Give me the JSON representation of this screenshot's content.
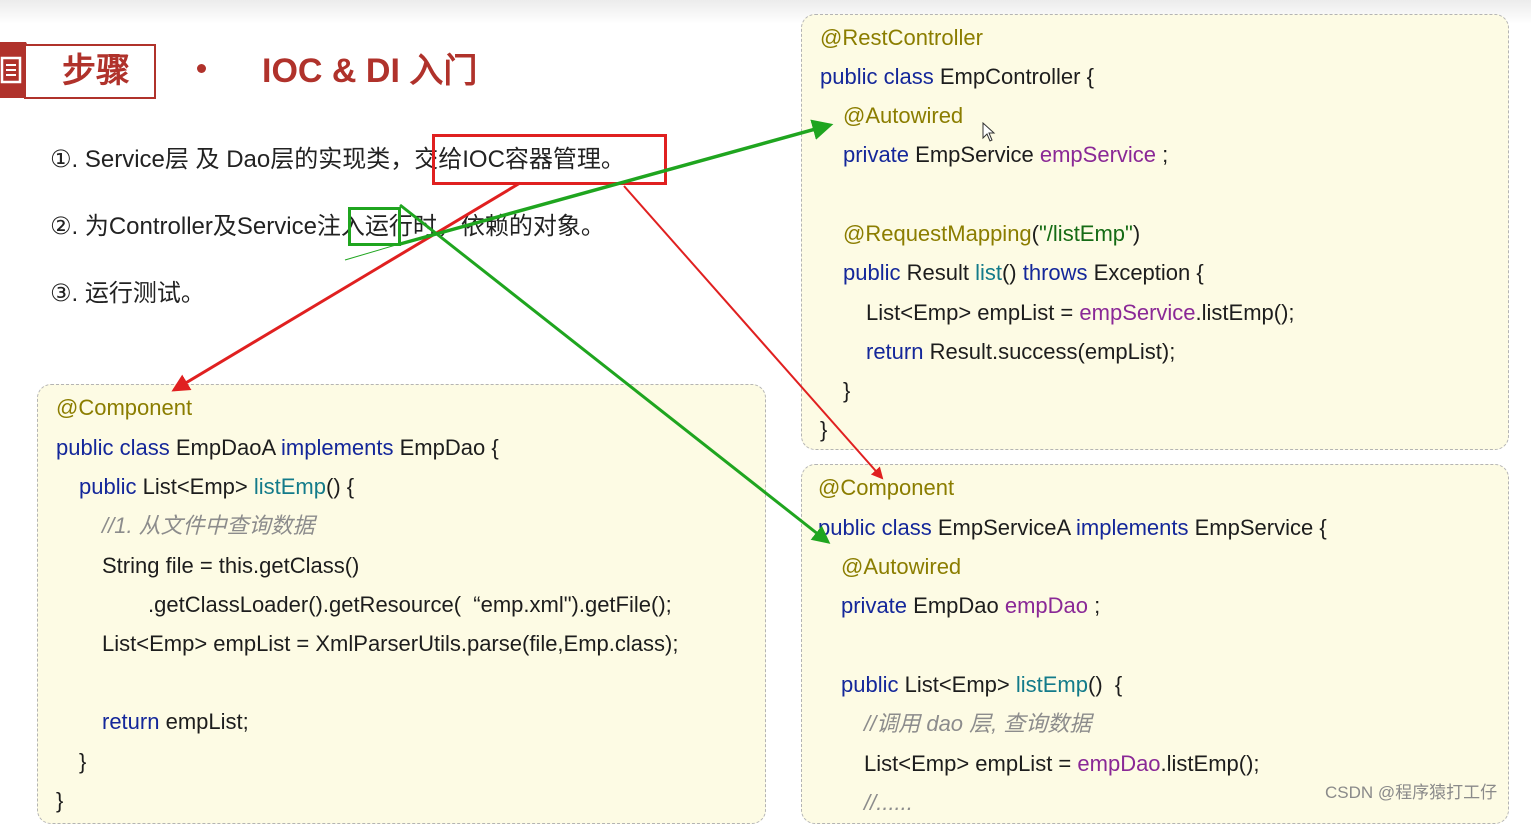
{
  "header": {
    "section_label": "步骤",
    "title": "IOC & DI 入门"
  },
  "steps": [
    "①. Service层 及 Dao层的实现类，交给IOC容器管理。",
    "②. 为Controller及Service注入运行时，依赖的对象。",
    "③. 运行测试。"
  ],
  "highlights": {
    "red": "交给IOC容器管理。",
    "green": "注入"
  },
  "code_blocks": {
    "controller": [
      "@RestController",
      "public class EmpController {",
      "@Autowired",
      "private EmpService empService ;",
      "@RequestMapping(\"/listEmp\")",
      "public Result list() throws Exception {",
      "List<Emp> empList = empService.listEmp();",
      "return Result.success(empList);",
      "}",
      "}"
    ],
    "dao": [
      "@Component",
      "public class EmpDaoA implements EmpDao {",
      "public List<Emp> listEmp() {",
      "//1. 从文件中查询数据",
      "String file = this.getClass()",
      ".getClassLoader().getResource(  “emp.xml\").getFile();",
      "List<Emp> empList = XmlParserUtils.parse(file,Emp.class);",
      "return empList;",
      "}",
      "}"
    ],
    "service": [
      "@Component",
      "public class EmpServiceA implements EmpService {",
      "@Autowired",
      "private EmpDao empDao ;",
      "public List<Emp> listEmp()  {",
      "//调用 dao 层, 查询数据",
      "List<Emp> empList = empDao.listEmp();",
      "//......"
    ]
  },
  "colors": {
    "accent": "#b0322b",
    "annotation": "#8b7d00",
    "keyword": "#14279a",
    "member": "#8a2896",
    "arrow_red": "#e02020",
    "arrow_green": "#1fa51f",
    "code_bg": "#fdfbe4"
  },
  "icons": [
    "document-icon",
    "cursor-icon"
  ],
  "watermark": "CSDN @程序猿打工仔"
}
